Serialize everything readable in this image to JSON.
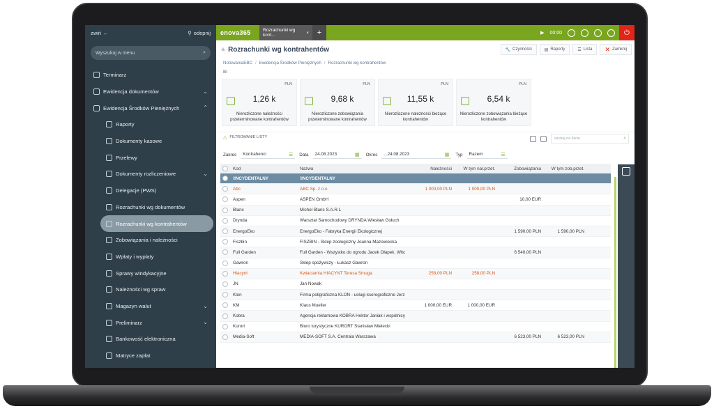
{
  "sidebar": {
    "collapse_label": "zwiń",
    "unpin_label": "odepnij",
    "search_placeholder": "Wyszukuj w menu",
    "items": [
      {
        "label": "Terminarz",
        "sub": false,
        "chevron": ""
      },
      {
        "label": "Ewidencja dokumentów",
        "sub": false,
        "chevron": "⌄"
      },
      {
        "label": "Ewidencja Środków Pieniężnych",
        "sub": false,
        "chevron": "⌃"
      },
      {
        "label": "Raporty",
        "sub": true,
        "chevron": ""
      },
      {
        "label": "Dokumenty kasowe",
        "sub": true,
        "chevron": ""
      },
      {
        "label": "Przelewy",
        "sub": true,
        "chevron": ""
      },
      {
        "label": "Dokumenty rozliczeniowe",
        "sub": true,
        "chevron": "⌄"
      },
      {
        "label": "Delegacje (PWS)",
        "sub": true,
        "chevron": ""
      },
      {
        "label": "Rozrachunki wg dokumentów",
        "sub": true,
        "chevron": ""
      },
      {
        "label": "Rozrachunki wg kontrahentów",
        "sub": true,
        "chevron": "",
        "active": true
      },
      {
        "label": "Zobowiązania i należności",
        "sub": true,
        "chevron": ""
      },
      {
        "label": "Wpłaty i wypłaty",
        "sub": true,
        "chevron": ""
      },
      {
        "label": "Sprawy windykacyjne",
        "sub": true,
        "chevron": ""
      },
      {
        "label": "Należności wg spraw",
        "sub": true,
        "chevron": ""
      },
      {
        "label": "Magazyn walut",
        "sub": true,
        "chevron": "⌄"
      },
      {
        "label": "Preliminarz",
        "sub": true,
        "chevron": "⌄"
      },
      {
        "label": "Bankowość elektroniczna",
        "sub": true,
        "chevron": ""
      },
      {
        "label": "Matryce zapłat",
        "sub": true,
        "chevron": ""
      }
    ]
  },
  "topbar": {
    "logo": "enova365",
    "tab_label": "Rozrachunki wg kont...",
    "tab_close": "×",
    "add_tab": "+",
    "timer": "00:00",
    "accent": "#7aa51f"
  },
  "page": {
    "title": "Rozrachunki wg kontrahentów",
    "actions": [
      "Czynności",
      "Raporty",
      "Lista",
      "Zamknij"
    ],
    "breadcrumbs": [
      "NotowaniaEBC",
      "Ewidencja Środków Pieniężnych",
      "Rozrachunki wg kontrahentów"
    ],
    "bi_label": "BI"
  },
  "kpis": [
    {
      "currency": "PLN",
      "value": "1,26 k",
      "label": "Nierozliczone należności przeterminowane kontrahentów"
    },
    {
      "currency": "PLN",
      "value": "9,68 k",
      "label": "Nierozliczone zobowiązania przeterminowane kontrahentów"
    },
    {
      "currency": "PLN",
      "value": "11,55 k",
      "label": "Nierozliczone należności bieżące kontrahentów"
    },
    {
      "currency": "PLN",
      "value": "6,54 k",
      "label": "Nierozliczone zobowiązania bieżące kontrahentów"
    }
  ],
  "filters": {
    "heading": "FILTROWANIE LISTY",
    "search_placeholder": "szukaj na liście",
    "zakres_label": "Zakres",
    "zakres_value": "Kontrahenci",
    "data_label": "Data",
    "data_value": "24.08.2023",
    "okres_label": "Okres",
    "okres_value": "...24.08.2023",
    "typ_label": "Typ",
    "typ_value": "Razem"
  },
  "grid": {
    "columns": [
      "Kod",
      "Nazwa",
      "Należności",
      "W tym nal.przet.",
      "Zobowiązania",
      "W tym zob.przet."
    ],
    "rows": [
      {
        "kod": "!INCYDENTALNY",
        "nazwa": "!INCYDENTALNY",
        "n": "",
        "np": "",
        "z": "",
        "zp": "",
        "type": "group"
      },
      {
        "kod": "Abc",
        "nazwa": "ABC Sp. z o.o",
        "n": "1 000,00 PLN",
        "np": "1 000,00 PLN",
        "z": "",
        "zp": "",
        "type": "orange"
      },
      {
        "kod": "Aspen",
        "nazwa": "ASPEN GmbH",
        "n": "",
        "np": "",
        "z": "10,00 EUR",
        "zp": "",
        "type": ""
      },
      {
        "kod": "Blanc",
        "nazwa": "Michel Blanc S.A.R.L",
        "n": "",
        "np": "",
        "z": "",
        "zp": "",
        "type": ""
      },
      {
        "kod": "Drynda",
        "nazwa": "Warsztat Samochodowy DRYNDA Wiesław Gołuch",
        "n": "",
        "np": "",
        "z": "",
        "zp": "",
        "type": ""
      },
      {
        "kod": "EnergoEko",
        "nazwa": "EnergoEko - Fabryka Energii Ekologicznej",
        "n": "",
        "np": "",
        "z": "1 590,00 PLN",
        "zp": "1 590,00 PLN",
        "type": ""
      },
      {
        "kod": "Fiszbin",
        "nazwa": "FISZBIN - Sklep zoologiczny Joanna Mazowiecka",
        "n": "",
        "np": "",
        "z": "",
        "zp": "",
        "type": ""
      },
      {
        "kod": "Full Garden",
        "nazwa": "Full Garden - Wszystko do ogrodu Jacek Ołapek, Witc",
        "n": "",
        "np": "",
        "z": "6 540,00 PLN",
        "zp": "",
        "type": ""
      },
      {
        "kod": "Gawron",
        "nazwa": "Sklep spożywczy - Łukasz Gawron",
        "n": "",
        "np": "",
        "z": "",
        "zp": "",
        "type": ""
      },
      {
        "kod": "Hiacynt",
        "nazwa": "Kwiaciarnia HIACYNT Teresa Smuga",
        "n": "258,00 PLN",
        "np": "258,00 PLN",
        "z": "",
        "zp": "",
        "type": "orange"
      },
      {
        "kod": "JN",
        "nazwa": "Jan Nowak",
        "n": "",
        "np": "",
        "z": "",
        "zp": "",
        "type": ""
      },
      {
        "kod": "Klon",
        "nazwa": "Firma poligraficzna KLON - usługi kserograficzne Jerz",
        "n": "",
        "np": "",
        "z": "",
        "zp": "",
        "type": ""
      },
      {
        "kod": "KM",
        "nazwa": "Klaus Mueller",
        "n": "1 000,00 EUR",
        "np": "1 000,00 EUR",
        "z": "",
        "zp": "",
        "type": ""
      },
      {
        "kod": "Kobra",
        "nazwa": "Agencja reklamowa KOBRA Hektor Janiak i wspólnicy",
        "n": "",
        "np": "",
        "z": "",
        "zp": "",
        "type": ""
      },
      {
        "kod": "Kurort",
        "nazwa": "Biuro turystyczne KURORT Stanisław Mielecki",
        "n": "",
        "np": "",
        "z": "",
        "zp": "",
        "type": ""
      },
      {
        "kod": "Media-Soft",
        "nazwa": "MEDIA-SOFT S.A. Centrala Warszawa",
        "n": "",
        "np": "",
        "z": "6 523,00 PLN",
        "zp": "6 523,00 PLN",
        "type": ""
      }
    ]
  }
}
